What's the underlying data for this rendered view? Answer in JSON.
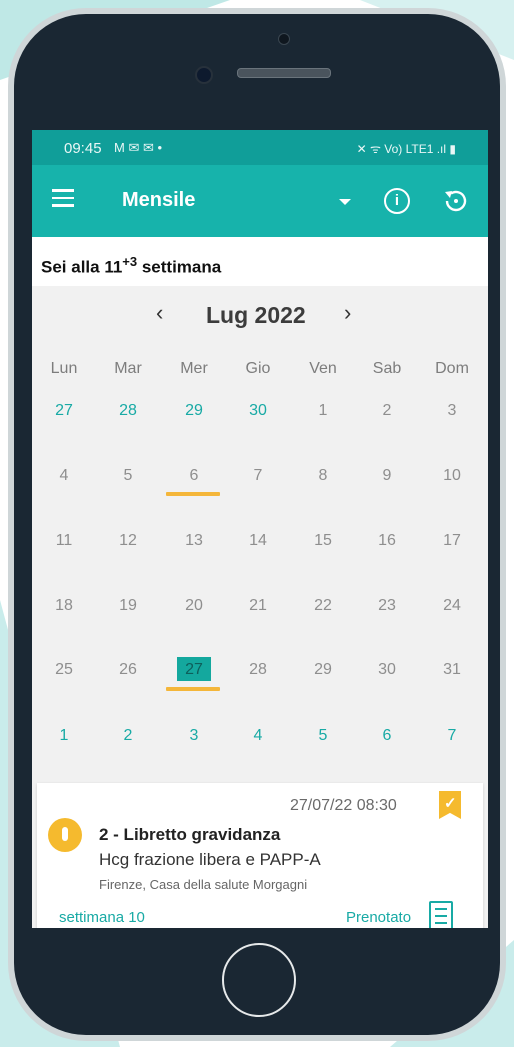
{
  "status_bar": {
    "time": "09:45",
    "notification_icons": "M ✉ ✉ •",
    "system_icons": "✕ ᯤ Vo) LTE1 .ıl ▮"
  },
  "app_bar": {
    "title": "Mensile",
    "menu_icon": "hamburger-menu-icon",
    "dropdown_icon": "caret-down-icon",
    "info_icon": "info-icon",
    "history_icon": "history-icon"
  },
  "pregnancy": {
    "prefix": "Sei alla 11",
    "sup": "+3",
    "suffix": " settimana"
  },
  "calendar": {
    "month_label": "Lug 2022",
    "prev_label": "‹",
    "next_label": "›",
    "weekdays": [
      "Lun",
      "Mar",
      "Mer",
      "Gio",
      "Ven",
      "Sab",
      "Dom"
    ],
    "weeks": [
      [
        "27",
        "28",
        "29",
        "30",
        "1",
        "2",
        "3"
      ],
      [
        "4",
        "5",
        "6",
        "7",
        "8",
        "9",
        "10"
      ],
      [
        "11",
        "12",
        "13",
        "14",
        "15",
        "16",
        "17"
      ],
      [
        "18",
        "19",
        "20",
        "21",
        "22",
        "23",
        "24"
      ],
      [
        "25",
        "26",
        "27",
        "28",
        "29",
        "30",
        "31"
      ],
      [
        "1",
        "2",
        "3",
        "4",
        "5",
        "6",
        "7"
      ]
    ]
  },
  "appointment": {
    "datetime": "27/07/22 08:30",
    "title": "2 - Libretto gravidanza",
    "subtitle": "Hcg frazione libera e PAPP-A",
    "location": "Firenze, Casa della salute Morgagni",
    "week": "settimana 10",
    "status": "Prenotato",
    "bookmark_icon": "check",
    "colors": {
      "accent": "#17b3ab",
      "warning": "#f5ba2e"
    }
  }
}
